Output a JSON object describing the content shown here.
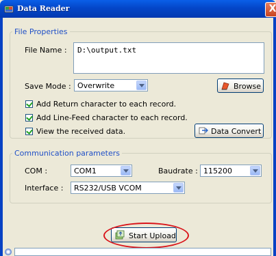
{
  "window": {
    "title": "Data Reader",
    "close_glyph": "X"
  },
  "file_properties": {
    "legend": "File Properties",
    "file_name_label": "File Name :",
    "file_name_value": "D:\\output.txt",
    "save_mode_label": "Save Mode :",
    "save_mode_value": "Overwrite",
    "browse_label": "Browse",
    "checkboxes": [
      {
        "label": "Add Return character to each record.",
        "checked": true
      },
      {
        "label": "Add Line-Feed character to each record.",
        "checked": true
      },
      {
        "label": "View the received data.",
        "checked": true
      }
    ],
    "data_convert_label": "Data Convert"
  },
  "communication": {
    "legend": "Communication parameters",
    "com_label": "COM :",
    "com_value": "COM1",
    "baudrate_label": "Baudrate :",
    "baudrate_value": "115200",
    "interface_label": "Interface :",
    "interface_value": "RS232/USB VCOM"
  },
  "actions": {
    "start_upload_label": "Start Upload"
  },
  "colors": {
    "title_bar": "#0446c8",
    "group_legend": "#1f4fc6",
    "highlight": "#d9141a"
  }
}
